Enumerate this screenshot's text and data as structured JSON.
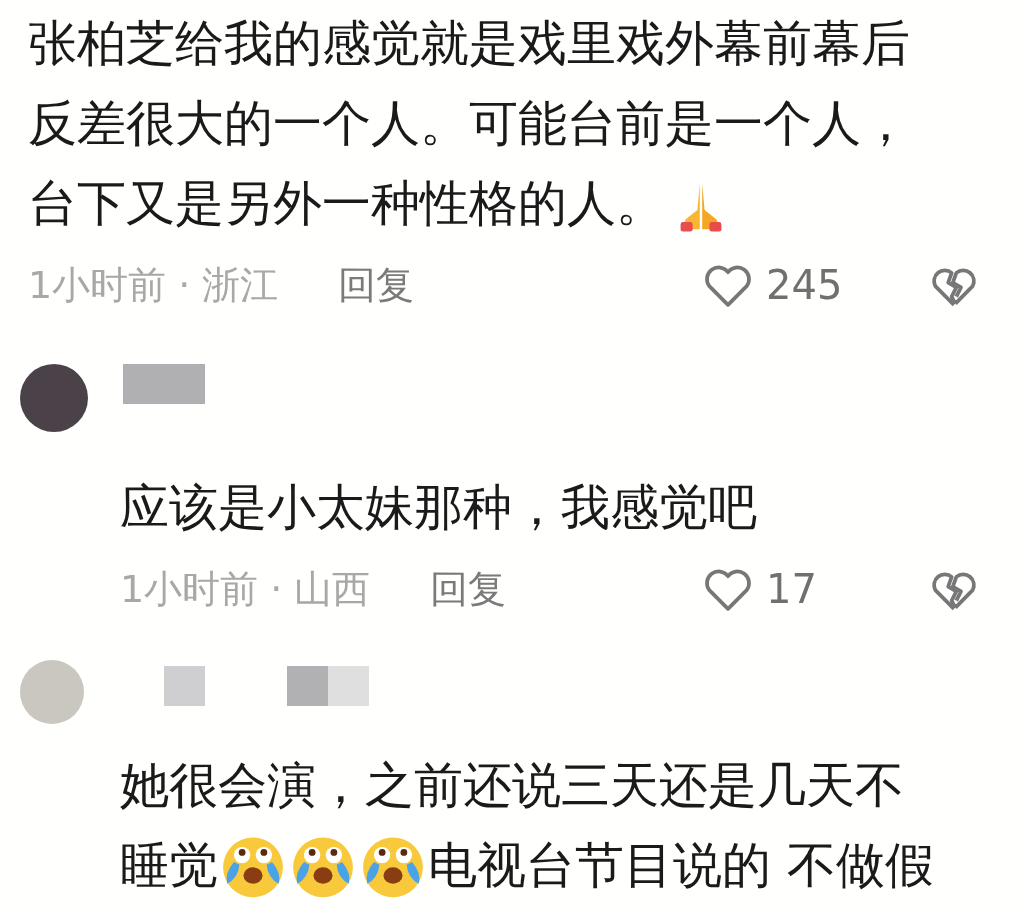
{
  "comments": [
    {
      "kind": "top",
      "lines": [
        [
          {
            "kind": "text",
            "text": "张柏芝给我的感觉就是戏里戏外幕前幕后"
          }
        ],
        [
          {
            "kind": "text",
            "text": "反差很大的一个人。可能台前是一个人，"
          }
        ],
        [
          {
            "kind": "text",
            "text": "台下又是另外一种性格的人。"
          },
          {
            "kind": "pray"
          }
        ]
      ],
      "time": "1小时前 · 浙江",
      "reply": "回复",
      "likes": "245"
    },
    {
      "kind": "reply",
      "lines": [
        [
          {
            "kind": "text",
            "text": "应该是小太妹那种，我感觉吧"
          }
        ]
      ],
      "time": "1小时前 · 山西",
      "reply": "回复",
      "likes": "17"
    },
    {
      "kind": "reply",
      "lines": [
        [
          {
            "kind": "text",
            "text": "她很会演，之前还说三天还是几天不"
          }
        ],
        [
          {
            "kind": "text",
            "text": "睡觉"
          },
          {
            "kind": "crying"
          },
          {
            "kind": "crying"
          },
          {
            "kind": "crying"
          },
          {
            "kind": "text",
            "text": "电视台节目说的 不做假"
          }
        ]
      ]
    }
  ]
}
